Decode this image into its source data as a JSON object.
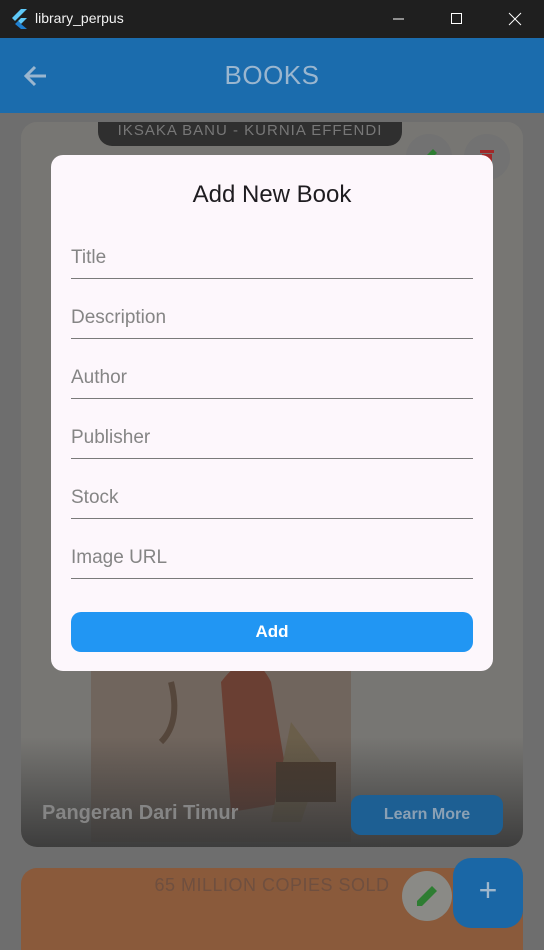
{
  "window": {
    "title": "library_perpus"
  },
  "appbar": {
    "title": "BOOKS",
    "back_icon": "arrow-left-icon"
  },
  "background": {
    "card1": {
      "cover_top_text": "IKSAKA BANU - KURNIA EFFENDI",
      "book_title": "Pangeran Dari Timur",
      "learn_more_label": "Learn More"
    },
    "card2": {
      "banner_text": "65 MILLION COPIES SOLD"
    },
    "fab_label": "+"
  },
  "dialog": {
    "title": "Add New Book",
    "fields": [
      {
        "placeholder": "Title",
        "value": ""
      },
      {
        "placeholder": "Description",
        "value": ""
      },
      {
        "placeholder": "Author",
        "value": ""
      },
      {
        "placeholder": "Publisher",
        "value": ""
      },
      {
        "placeholder": "Stock",
        "value": ""
      },
      {
        "placeholder": "Image URL",
        "value": ""
      }
    ],
    "submit_label": "Add"
  },
  "colors": {
    "appbar": "#1b6cad",
    "primary_button": "#2196f3",
    "dialog_bg": "#fdf7fc",
    "edit_icon": "#2e7d32",
    "delete_icon": "#c62828"
  }
}
